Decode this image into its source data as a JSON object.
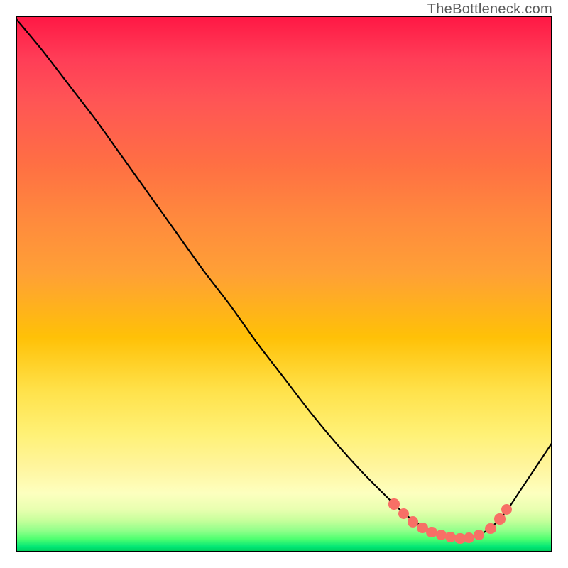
{
  "attribution": "TheBottleneck.com",
  "colors": {
    "curve": "#000000",
    "dot": "#f77066",
    "frame": "#000000"
  },
  "chart_data": {
    "type": "line",
    "title": "",
    "xlabel": "",
    "ylabel": "",
    "xlim": [
      0,
      100
    ],
    "ylim": [
      0,
      100
    ],
    "grid": false,
    "legend": false,
    "annotations": [
      "TheBottleneck.com"
    ],
    "series": [
      {
        "name": "bottleneck-curve",
        "x": [
          0,
          5,
          10,
          15,
          20,
          25,
          30,
          35,
          40,
          45,
          50,
          55,
          60,
          65,
          70,
          72,
          74,
          76,
          78,
          80,
          82,
          84,
          86,
          88,
          90,
          92,
          94,
          96,
          98,
          100
        ],
        "y": [
          99.5,
          93.5,
          87,
          80.5,
          73.5,
          66.5,
          59.5,
          52.5,
          46,
          39,
          32.5,
          26,
          20,
          14.5,
          9.5,
          7.6,
          6.0,
          4.7,
          3.7,
          3.0,
          2.6,
          2.6,
          3.1,
          4.2,
          6.0,
          8.5,
          11.5,
          14.5,
          17.5,
          20.5
        ]
      }
    ],
    "markers": {
      "name": "highlight-dots",
      "x": [
        70.5,
        72.3,
        74.0,
        75.8,
        77.5,
        79.3,
        81.0,
        82.8,
        84.5,
        86.3,
        88.5,
        90.2,
        91.5
      ],
      "y": [
        9.0,
        7.2,
        5.7,
        4.6,
        3.8,
        3.2,
        2.8,
        2.6,
        2.7,
        3.2,
        4.4,
        6.2,
        8.0
      ]
    }
  }
}
